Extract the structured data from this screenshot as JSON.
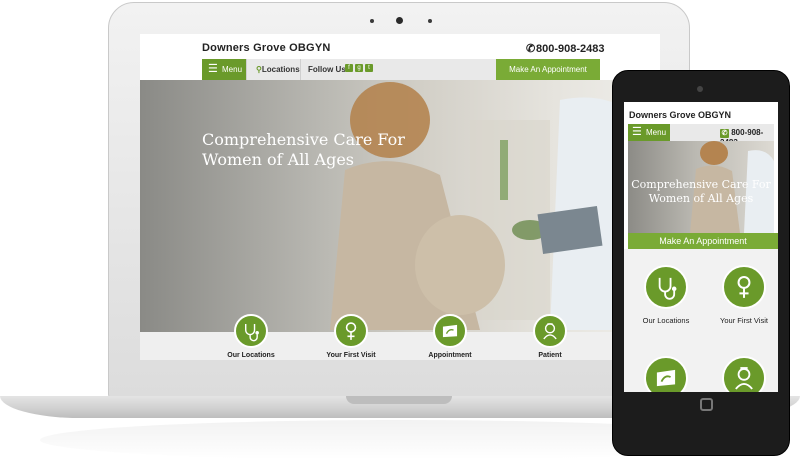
{
  "site": {
    "brand": "Downers Grove OBGYN",
    "phone": "800-908-2483",
    "menu_label": "Menu",
    "locations_label": "Locations",
    "follow_label": "Follow Us:",
    "social": [
      "f",
      "g",
      "t"
    ],
    "appointment_label": "Make An Appointment",
    "hero_title_line1": "Comprehensive Care For",
    "hero_title_line2": "Women of All Ages",
    "features": [
      {
        "label": "Our Locations",
        "icon": "stethoscope-icon"
      },
      {
        "label": "Your First Visit",
        "icon": "female-symbol-icon"
      },
      {
        "label": "Appointment",
        "icon": "ultrasound-icon"
      },
      {
        "label": "Patient",
        "icon": "nurse-icon"
      }
    ]
  },
  "colors": {
    "brand_green": "#6a9a2a",
    "accent_green": "#7aab36"
  }
}
